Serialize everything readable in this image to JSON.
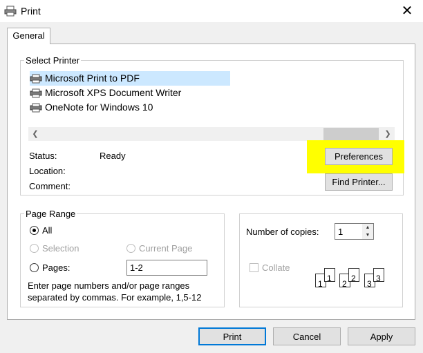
{
  "window": {
    "title": "Print"
  },
  "tabs": [
    {
      "label": "General"
    }
  ],
  "select_printer": {
    "legend": "Select Printer",
    "printers": [
      {
        "name": "Microsoft Print to PDF",
        "selected": true
      },
      {
        "name": "Microsoft XPS Document Writer",
        "selected": false
      },
      {
        "name": "OneNote for Windows 10",
        "selected": false
      }
    ],
    "status_label": "Status:",
    "status_value": "Ready",
    "location_label": "Location:",
    "comment_label": "Comment:",
    "preferences_label": "Preferences",
    "find_printer_label": "Find Printer..."
  },
  "page_range": {
    "legend": "Page Range",
    "all_label": "All",
    "selection_label": "Selection",
    "current_page_label": "Current Page",
    "pages_label": "Pages:",
    "pages_value": "1-2",
    "help_line1": "Enter page numbers and/or page ranges",
    "help_line2": "separated by commas.  For example, 1,5-12"
  },
  "copies": {
    "label": "Number of copies:",
    "value": "1",
    "collate_label": "Collate",
    "collate_checked": false
  },
  "footer": {
    "print_label": "Print",
    "cancel_label": "Cancel",
    "apply_label": "Apply"
  },
  "colors": {
    "accent": "#0078d7",
    "highlight": "#ffff00",
    "selection": "#cce8ff"
  }
}
